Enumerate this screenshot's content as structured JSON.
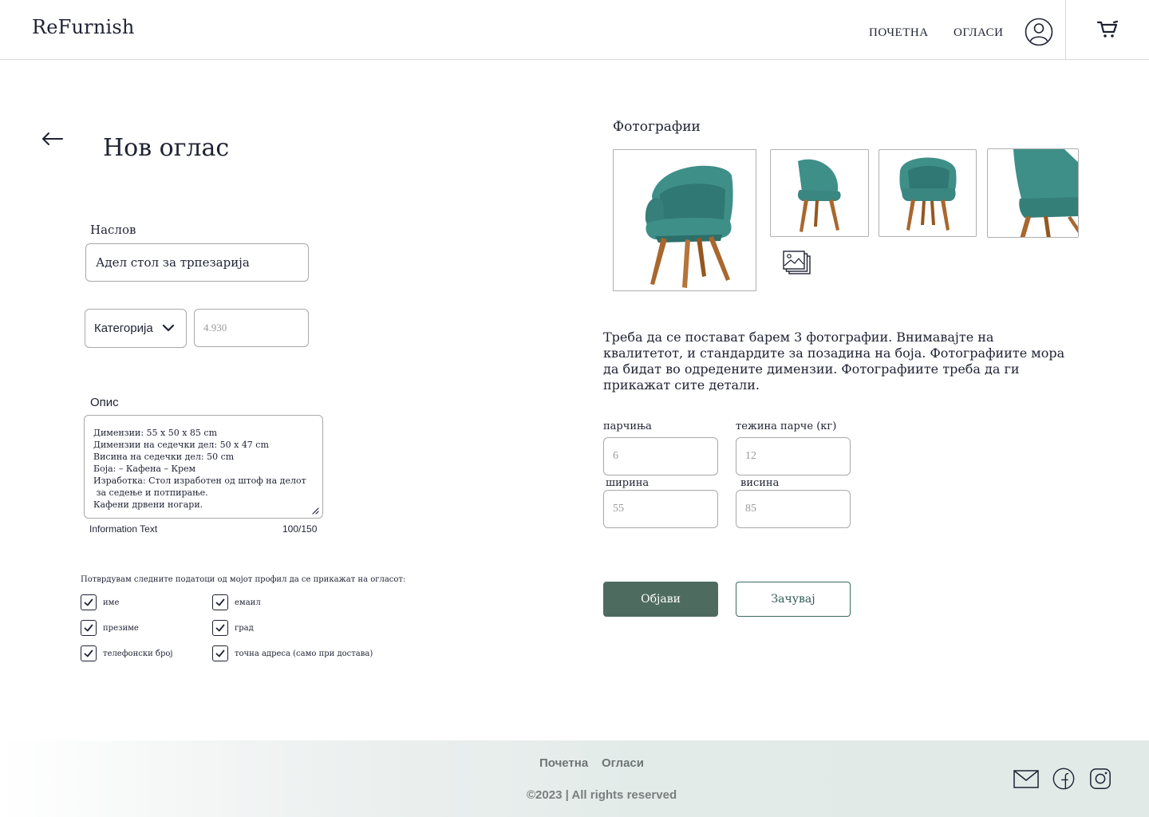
{
  "header": {
    "logo": "ReFurnish",
    "nav": {
      "home": "ПОЧЕТНА",
      "ads": "ОГЛАСИ"
    },
    "icons": {
      "user": "user-icon",
      "cart": "cart-icon"
    }
  },
  "page": {
    "title": "Нов оглас",
    "back_icon": "arrow-left-icon"
  },
  "form": {
    "title_label": "Наслов",
    "title_value": "Адел стол за трпезарија",
    "category_label": "Категорија",
    "price_placeholder": "4.930",
    "description_label": "Опис",
    "description_lines": [
      "Димензии: 55 x 50 x 85 cm",
      "Димензии на седечки дел: 50 x 47 cm",
      "Висина на седечки дел: 50 cm",
      "Боја: – Кафена – Крем",
      "Изработка: Стол изработен од штоф на делот",
      " за седење и потпирање.",
      "Кафени дрвени ногари."
    ],
    "info_text": "Information Text",
    "char_count": "100/150",
    "confirm_text": "Потврдувам следните податоци од мојот профил да се прикажат на огласот:",
    "checkboxes": [
      {
        "label": "име",
        "checked": true
      },
      {
        "label": "презиме",
        "checked": true
      },
      {
        "label": "телефонски број",
        "checked": true
      },
      {
        "label": "емаил",
        "checked": true
      },
      {
        "label": "град",
        "checked": true
      },
      {
        "label": "точна адреса (само при достава)",
        "checked": true
      }
    ]
  },
  "photos": {
    "label": "Фотографии",
    "hint": "Треба да се постават барем 3 фотографии. Внимавајте на квалитетот, и стандардите за позадина на боја. Фотографиите мора да бидат во одредените димензии. Фотографиите треба да ги прикажат сите детали.",
    "chair_color": "#3f8f89",
    "leg_color": "#a8672e"
  },
  "specs": {
    "pieces_label": "парчиња",
    "pieces_placeholder": "6",
    "weight_label": "тежина парче (кг)",
    "weight_placeholder": "12",
    "width_label": "ширина",
    "width_placeholder": "55",
    "height_label": "висина",
    "height_placeholder": "85"
  },
  "actions": {
    "publish": "Објави",
    "save": "Зачувај"
  },
  "footer": {
    "home": "Почетна",
    "ads": "Огласи",
    "copyright": "©2023 | All rights reserved",
    "icons": [
      "mail-icon",
      "facebook-icon",
      "instagram-icon"
    ]
  },
  "colors": {
    "accent": "#4e6b60",
    "text": "#1f2233",
    "border": "#a9a9a9"
  }
}
